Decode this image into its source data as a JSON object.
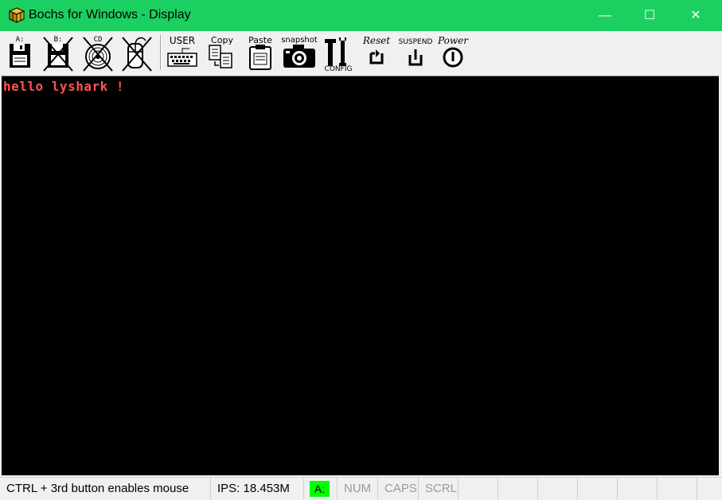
{
  "window": {
    "title": "Bochs for Windows - Display",
    "minimize_glyph": "—",
    "maximize_glyph": "☐",
    "close_glyph": "✕",
    "titlebar_color": "#1bd061"
  },
  "toolbar": {
    "floppy_a_label": "A:",
    "floppy_b_label": "B:",
    "cdrom_label": "CD",
    "user_label": "USER",
    "copy_label": "Copy",
    "paste_label": "Paste",
    "snapshot_label": "snapshot",
    "config_label": "CONFIG",
    "reset_label": "Reset",
    "suspend_label": "SUSPEND",
    "power_label": "Power"
  },
  "screen": {
    "text": "hello lyshark !",
    "text_color": "#ff5454",
    "background": "#000000"
  },
  "statusbar": {
    "mouse_hint": "CTRL + 3rd button enables mouse",
    "ips": "IPS: 18.453M",
    "drive_indicator": "A:",
    "num": "NUM",
    "caps": "CAPS",
    "scrl": "SCRL",
    "indicator_color": "#00ff00"
  }
}
